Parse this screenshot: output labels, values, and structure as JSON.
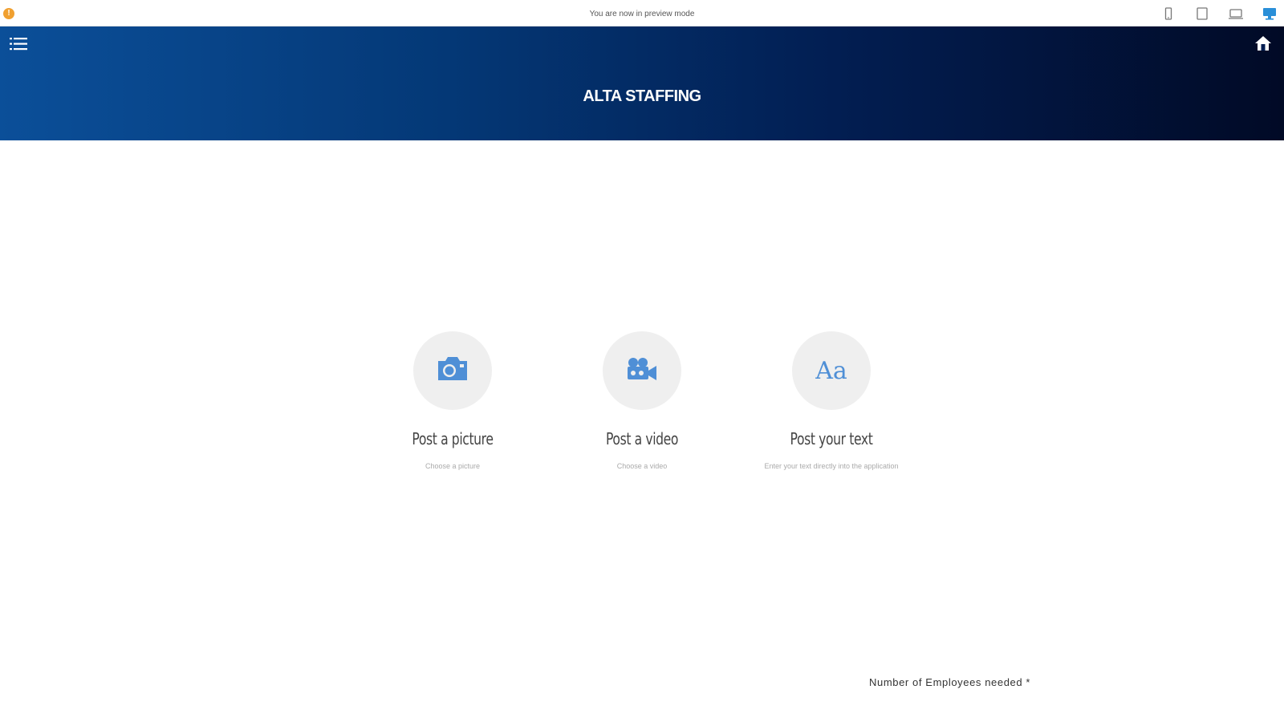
{
  "preview_bar": {
    "message": "You are now in preview mode",
    "warning_glyph": "!",
    "devices": [
      "phone-icon",
      "tablet-icon",
      "laptop-icon",
      "desktop-icon"
    ],
    "active_device_color": "#2a8fd8"
  },
  "header": {
    "title": "ALTA STAFFING",
    "gradient_colors": [
      "#0b4f99",
      "#010a26"
    ]
  },
  "options": [
    {
      "icon": "camera-icon",
      "title": "Post a picture",
      "subtitle": "Choose a picture"
    },
    {
      "icon": "video-camera-icon",
      "title": "Post a video",
      "subtitle": "Choose a video"
    },
    {
      "icon": "text-icon",
      "glyph": "Aa",
      "title": "Post your text",
      "subtitle": "Enter your text directly into the application"
    }
  ],
  "form": {
    "employees_label": "Number of Employees needed *"
  },
  "accent_color": "#4f8fd6"
}
